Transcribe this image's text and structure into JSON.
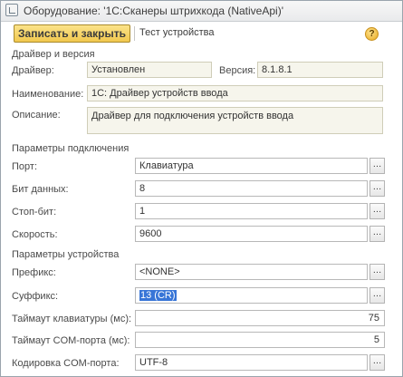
{
  "window": {
    "title": "Оборудование: '1С:Сканеры штрихкода (NativeApi)'"
  },
  "toolbar": {
    "save_label": "Записать и закрыть",
    "test_label": "Тест устройства",
    "help_label": "?"
  },
  "driver": {
    "section_title": "Драйвер и версия",
    "driver_label": "Драйвер:",
    "driver_value": "Установлен",
    "version_label": "Версия:",
    "version_value": "8.1.8.1",
    "name_label": "Наименование:",
    "name_value": "1С: Драйвер устройств ввода",
    "description_label": "Описание:",
    "description_value": "Драйвер для подключения устройств ввода"
  },
  "connection": {
    "section_title": "Параметры подключения",
    "port_label": "Порт:",
    "port_value": "Клавиатура",
    "databits_label": "Бит данных:",
    "databits_value": "8",
    "stopbits_label": "Стоп-бит:",
    "stopbits_value": "1",
    "speed_label": "Скорость:",
    "speed_value": "9600"
  },
  "device": {
    "section_title": "Параметры устройства",
    "prefix_label": "Префикс:",
    "prefix_value": "<NONE>",
    "suffix_label": "Суффикс:",
    "suffix_value": "13 (CR)",
    "kb_timeout_label": "Таймаут клавиатуры (мс):",
    "kb_timeout_value": "75",
    "com_timeout_label": "Таймаут COM-порта (мс):",
    "com_timeout_value": "5",
    "encoding_label": "Кодировка COM-порта:",
    "encoding_value": "UTF-8"
  },
  "colors": {
    "save_button": "#f1c84e",
    "selection": "#3875d7",
    "readonly_field": "#f6f5ec"
  },
  "icons": {
    "title": "form-icon",
    "help": "help-icon",
    "select": "ellipsis-icon"
  }
}
